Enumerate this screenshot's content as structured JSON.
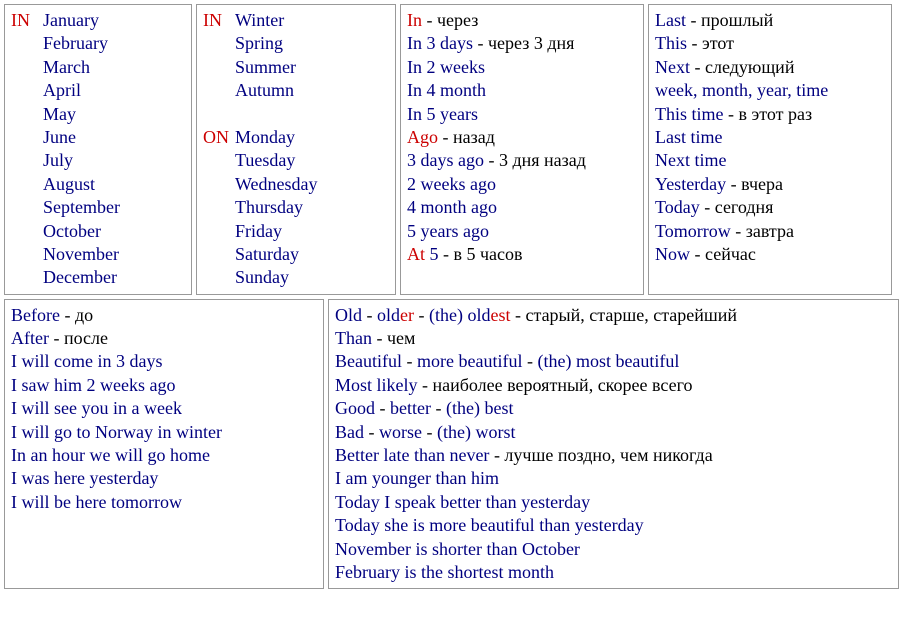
{
  "top": {
    "box1": {
      "prep": "IN",
      "items": [
        "January",
        "February",
        "March",
        "April",
        "May",
        "June",
        "July",
        "August",
        "September",
        "October",
        "November",
        "December"
      ]
    },
    "box2": {
      "groups": [
        {
          "prep": "IN",
          "items": [
            "Winter",
            "Spring",
            "Summer",
            "Autumn"
          ]
        },
        {
          "prep": "ON",
          "items": [
            "Monday",
            "Tuesday",
            "Wednesday",
            "Thursday",
            "Friday",
            "Saturday",
            "Sunday"
          ]
        }
      ]
    },
    "box3": {
      "lines": [
        [
          {
            "t": "In",
            "c": "red"
          },
          {
            "t": " - через",
            "c": "black"
          }
        ],
        [
          {
            "t": "In 3 days",
            "c": "navy"
          },
          {
            "t": " - через 3 дня",
            "c": "black"
          }
        ],
        [
          {
            "t": "In 2 weeks",
            "c": "navy"
          }
        ],
        [
          {
            "t": "In 4 month",
            "c": "navy"
          }
        ],
        [
          {
            "t": "In 5 years",
            "c": "navy"
          }
        ],
        [
          {
            "t": "Ago",
            "c": "red"
          },
          {
            "t": " - назад",
            "c": "black"
          }
        ],
        [
          {
            "t": "3 days ago",
            "c": "navy"
          },
          {
            "t": " - 3 дня назад",
            "c": "black"
          }
        ],
        [
          {
            "t": "2 weeks ago",
            "c": "navy"
          }
        ],
        [
          {
            "t": "4 month ago",
            "c": "navy"
          }
        ],
        [
          {
            "t": "5 years ago",
            "c": "navy"
          }
        ],
        [
          {
            "t": "At",
            "c": "red"
          },
          {
            "t": " 5",
            "c": "navy"
          },
          {
            "t": " - в 5 часов",
            "c": "black"
          }
        ]
      ]
    },
    "box4": {
      "lines": [
        [
          {
            "t": "Last",
            "c": "navy"
          },
          {
            "t": " - прошлый",
            "c": "black"
          }
        ],
        [
          {
            "t": "This",
            "c": "navy"
          },
          {
            "t": " - этот",
            "c": "black"
          }
        ],
        [
          {
            "t": "Next",
            "c": "navy"
          },
          {
            "t": " - следующий",
            "c": "black"
          }
        ],
        [
          {
            "t": "week, month, year, time",
            "c": "navy"
          }
        ],
        [
          {
            "t": "This time",
            "c": "navy"
          },
          {
            "t": " - в этот раз",
            "c": "black"
          }
        ],
        [
          {
            "t": "Last time",
            "c": "navy"
          }
        ],
        [
          {
            "t": "Next time",
            "c": "navy"
          }
        ],
        [
          {
            "t": "Yesterday",
            "c": "navy"
          },
          {
            "t": " - вчера",
            "c": "black"
          }
        ],
        [
          {
            "t": "Today",
            "c": "navy"
          },
          {
            "t": " - сегодня",
            "c": "black"
          }
        ],
        [
          {
            "t": "Tomorrow",
            "c": "navy"
          },
          {
            "t": " - завтра",
            "c": "black"
          }
        ],
        [
          {
            "t": "Now",
            "c": "navy"
          },
          {
            "t": " - сейчас",
            "c": "black"
          }
        ]
      ]
    }
  },
  "bottom": {
    "box1": {
      "lines": [
        [
          {
            "t": "Before",
            "c": "navy"
          },
          {
            "t": " - до",
            "c": "black"
          }
        ],
        [
          {
            "t": "After",
            "c": "navy"
          },
          {
            "t": " - после",
            "c": "black"
          }
        ],
        [
          {
            "t": "I will come in 3 days",
            "c": "navy"
          }
        ],
        [
          {
            "t": "I saw him 2 weeks ago",
            "c": "navy"
          }
        ],
        [
          {
            "t": "I will see you in a week",
            "c": "navy"
          }
        ],
        [
          {
            "t": "I will go to Norway in winter",
            "c": "navy"
          }
        ],
        [
          {
            "t": "In an hour we will go home",
            "c": "navy"
          }
        ],
        [
          {
            "t": "I was here yesterday",
            "c": "navy"
          }
        ],
        [
          {
            "t": "I will be here tomorrow",
            "c": "navy"
          }
        ]
      ]
    },
    "box2": {
      "lines": [
        [
          {
            "t": "Old",
            "c": "navy"
          },
          {
            "t": " - ",
            "c": "black"
          },
          {
            "t": "old",
            "c": "navy"
          },
          {
            "t": "er",
            "c": "red"
          },
          {
            "t": " - ",
            "c": "black"
          },
          {
            "t": "(the)",
            "c": "navy"
          },
          {
            "t": " ",
            "c": "black"
          },
          {
            "t": "old",
            "c": "navy"
          },
          {
            "t": "est",
            "c": "red"
          },
          {
            "t": " - старый, старше, старейший",
            "c": "black"
          }
        ],
        [
          {
            "t": "Than",
            "c": "navy"
          },
          {
            "t": " - чем",
            "c": "black"
          }
        ],
        [
          {
            "t": "Beautiful",
            "c": "navy"
          },
          {
            "t": " - ",
            "c": "black"
          },
          {
            "t": "more beautiful",
            "c": "navy"
          },
          {
            "t": " - ",
            "c": "black"
          },
          {
            "t": "(the)",
            "c": "navy"
          },
          {
            "t": " ",
            "c": "black"
          },
          {
            "t": "most beautiful",
            "c": "navy"
          }
        ],
        [
          {
            "t": "Most likely",
            "c": "navy"
          },
          {
            "t": " - наиболее вероятный, скорее всего",
            "c": "black"
          }
        ],
        [
          {
            "t": "Good",
            "c": "navy"
          },
          {
            "t": " - ",
            "c": "black"
          },
          {
            "t": "better",
            "c": "navy"
          },
          {
            "t": " - ",
            "c": "black"
          },
          {
            "t": "(the)",
            "c": "navy"
          },
          {
            "t": " ",
            "c": "black"
          },
          {
            "t": "best",
            "c": "navy"
          }
        ],
        [
          {
            "t": "Bad",
            "c": "navy"
          },
          {
            "t": " - ",
            "c": "black"
          },
          {
            "t": "worse",
            "c": "navy"
          },
          {
            "t": " - ",
            "c": "black"
          },
          {
            "t": "(the)",
            "c": "navy"
          },
          {
            "t": " ",
            "c": "black"
          },
          {
            "t": "worst",
            "c": "navy"
          }
        ],
        [
          {
            "t": "Better late than never",
            "c": "navy"
          },
          {
            "t": " - лучше поздно, чем никогда",
            "c": "black"
          }
        ],
        [
          {
            "t": "I am younger than him",
            "c": "navy"
          }
        ],
        [
          {
            "t": "Today I speak better than yesterday",
            "c": "navy"
          }
        ],
        [
          {
            "t": "Today she is more beautiful than yesterday",
            "c": "navy"
          }
        ],
        [
          {
            "t": "November is shorter than October",
            "c": "navy"
          }
        ],
        [
          {
            "t": "February is the shortest month",
            "c": "navy"
          }
        ]
      ]
    }
  }
}
